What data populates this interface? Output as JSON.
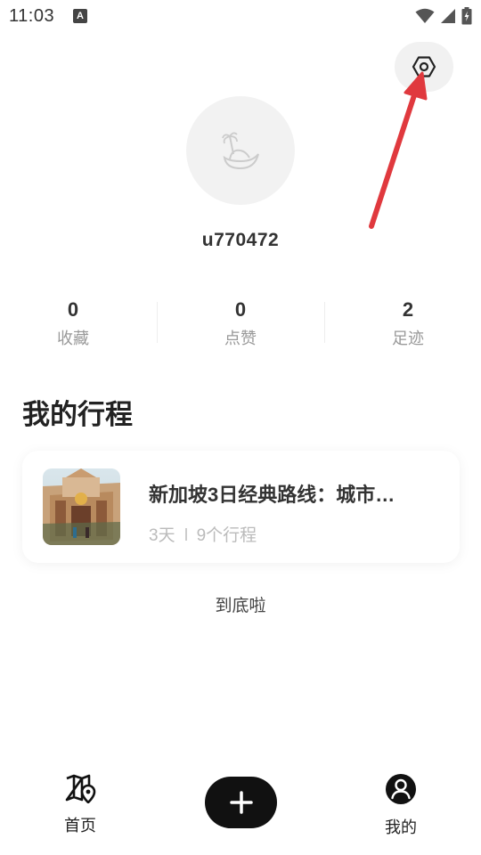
{
  "status_bar": {
    "time": "11:03",
    "notification_badge": "A",
    "icons": [
      "wifi-icon",
      "signal-icon",
      "battery-icon"
    ]
  },
  "header": {
    "settings_icon": "settings-hexagon-icon"
  },
  "profile": {
    "avatar_icon": "island-logo-icon",
    "username": "u770472"
  },
  "stats": [
    {
      "value": "0",
      "label": "收藏"
    },
    {
      "value": "0",
      "label": "点赞"
    },
    {
      "value": "2",
      "label": "足迹"
    }
  ],
  "section": {
    "title": "我的行程"
  },
  "trips": [
    {
      "title": "新加坡3日经典路线：城市…",
      "days": "3天",
      "count": "9个行程"
    }
  ],
  "list_end": "到底啦",
  "bottom_nav": {
    "home_label": "首页",
    "home_icon": "map-pin-icon",
    "add_icon": "plus-icon",
    "mine_label": "我的",
    "mine_icon": "user-circle-icon"
  },
  "colors": {
    "annotation_arrow": "#e0393e",
    "add_button": "#111111",
    "muted_text": "#999999"
  }
}
